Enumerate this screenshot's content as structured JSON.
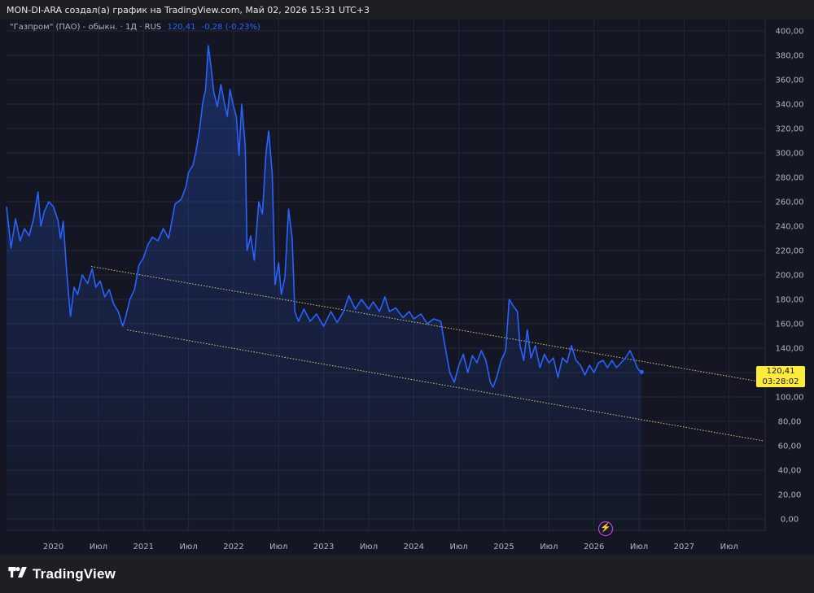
{
  "header": {
    "caption": "MON-DI-ARA создал(а) график на TradingView.com, Май 02, 2026 15:31 UTC+3"
  },
  "legend": {
    "symbol": "\"Газпром\" (ПАО) - обыкн. · 1Д · RUS",
    "price": "120,41",
    "change": "-0,28 (-0,23%)"
  },
  "price_tag": {
    "price": "120,41",
    "countdown": "03:28:02"
  },
  "brand": {
    "name": "TradingView",
    "logo_icon": "tradingview-logo-icon"
  },
  "colors": {
    "line": "#2962ff",
    "channel": "#e8e08c",
    "price_tag_bg": "#ffeb3b",
    "background": "#141723"
  },
  "chart_data": {
    "type": "area",
    "title": "",
    "xlabel": "",
    "ylabel": "",
    "ylim": [
      0,
      400
    ],
    "grid": true,
    "y_ticks": [
      "400,00",
      "380,00",
      "360,00",
      "340,00",
      "320,00",
      "300,00",
      "280,00",
      "260,00",
      "240,00",
      "220,00",
      "200,00",
      "180,00",
      "160,00",
      "140,00",
      "120,00",
      "100,00",
      "80,00",
      "60,00",
      "40,00",
      "20,00",
      "0,00"
    ],
    "x_ticks": [
      {
        "label": "2020",
        "date": 2020.0
      },
      {
        "label": "Июл",
        "date": 2020.5
      },
      {
        "label": "2021",
        "date": 2021.0
      },
      {
        "label": "Июл",
        "date": 2021.5
      },
      {
        "label": "2022",
        "date": 2022.0
      },
      {
        "label": "Июл",
        "date": 2022.5
      },
      {
        "label": "2023",
        "date": 2023.0
      },
      {
        "label": "Июл",
        "date": 2023.5
      },
      {
        "label": "2024",
        "date": 2024.0
      },
      {
        "label": "Июл",
        "date": 2024.5
      },
      {
        "label": "2025",
        "date": 2025.0
      },
      {
        "label": "Июл",
        "date": 2025.5
      },
      {
        "label": "2026",
        "date": 2026.0
      },
      {
        "label": "Июл",
        "date": 2026.5
      },
      {
        "label": "2027",
        "date": 2027.0
      },
      {
        "label": "Июл",
        "date": 2027.5
      }
    ],
    "series": [
      {
        "values": [
          [
            2019.48,
            256
          ],
          [
            2019.53,
            222
          ],
          [
            2019.58,
            246
          ],
          [
            2019.63,
            228
          ],
          [
            2019.68,
            238
          ],
          [
            2019.73,
            232
          ],
          [
            2019.78,
            246
          ],
          [
            2019.83,
            268
          ],
          [
            2019.86,
            240
          ],
          [
            2019.9,
            252
          ],
          [
            2019.95,
            260
          ],
          [
            2020.0,
            256
          ],
          [
            2020.05,
            245
          ],
          [
            2020.08,
            230
          ],
          [
            2020.11,
            244
          ],
          [
            2020.15,
            200
          ],
          [
            2020.19,
            166
          ],
          [
            2020.23,
            190
          ],
          [
            2020.27,
            184
          ],
          [
            2020.32,
            200
          ],
          [
            2020.38,
            193
          ],
          [
            2020.43,
            205
          ],
          [
            2020.47,
            190
          ],
          [
            2020.52,
            195
          ],
          [
            2020.57,
            182
          ],
          [
            2020.62,
            188
          ],
          [
            2020.67,
            176
          ],
          [
            2020.72,
            170
          ],
          [
            2020.77,
            158
          ],
          [
            2020.8,
            165
          ],
          [
            2020.85,
            180
          ],
          [
            2020.9,
            188
          ],
          [
            2020.95,
            208
          ],
          [
            2021.0,
            214
          ],
          [
            2021.05,
            225
          ],
          [
            2021.1,
            231
          ],
          [
            2021.16,
            228
          ],
          [
            2021.22,
            238
          ],
          [
            2021.28,
            230
          ],
          [
            2021.35,
            258
          ],
          [
            2021.42,
            262
          ],
          [
            2021.47,
            272
          ],
          [
            2021.5,
            284
          ],
          [
            2021.55,
            290
          ],
          [
            2021.58,
            300
          ],
          [
            2021.62,
            318
          ],
          [
            2021.66,
            342
          ],
          [
            2021.69,
            352
          ],
          [
            2021.72,
            388
          ],
          [
            2021.75,
            370
          ],
          [
            2021.78,
            350
          ],
          [
            2021.82,
            338
          ],
          [
            2021.86,
            356
          ],
          [
            2021.9,
            340
          ],
          [
            2021.93,
            330
          ],
          [
            2021.96,
            352
          ],
          [
            2022.0,
            338
          ],
          [
            2022.03,
            330
          ],
          [
            2022.06,
            298
          ],
          [
            2022.09,
            340
          ],
          [
            2022.13,
            306
          ],
          [
            2022.15,
            220
          ],
          [
            2022.19,
            232
          ],
          [
            2022.23,
            212
          ],
          [
            2022.28,
            260
          ],
          [
            2022.32,
            250
          ],
          [
            2022.36,
            300
          ],
          [
            2022.39,
            318
          ],
          [
            2022.43,
            282
          ],
          [
            2022.46,
            192
          ],
          [
            2022.5,
            210
          ],
          [
            2022.53,
            184
          ],
          [
            2022.57,
            198
          ],
          [
            2022.61,
            254
          ],
          [
            2022.65,
            230
          ],
          [
            2022.68,
            170
          ],
          [
            2022.72,
            162
          ],
          [
            2022.78,
            172
          ],
          [
            2022.85,
            162
          ],
          [
            2022.92,
            168
          ],
          [
            2023.0,
            158
          ],
          [
            2023.08,
            170
          ],
          [
            2023.15,
            161
          ],
          [
            2023.22,
            170
          ],
          [
            2023.28,
            183
          ],
          [
            2023.35,
            172
          ],
          [
            2023.42,
            180
          ],
          [
            2023.5,
            172
          ],
          [
            2023.55,
            178
          ],
          [
            2023.62,
            170
          ],
          [
            2023.68,
            182
          ],
          [
            2023.73,
            170
          ],
          [
            2023.8,
            173
          ],
          [
            2023.88,
            165
          ],
          [
            2023.95,
            170
          ],
          [
            2024.0,
            164
          ],
          [
            2024.08,
            168
          ],
          [
            2024.15,
            160
          ],
          [
            2024.22,
            164
          ],
          [
            2024.3,
            162
          ],
          [
            2024.35,
            140
          ],
          [
            2024.4,
            120
          ],
          [
            2024.45,
            112
          ],
          [
            2024.5,
            126
          ],
          [
            2024.55,
            135
          ],
          [
            2024.6,
            120
          ],
          [
            2024.65,
            134
          ],
          [
            2024.7,
            128
          ],
          [
            2024.75,
            138
          ],
          [
            2024.8,
            130
          ],
          [
            2024.85,
            112
          ],
          [
            2024.88,
            108
          ],
          [
            2024.92,
            116
          ],
          [
            2024.97,
            130
          ],
          [
            2025.02,
            138
          ],
          [
            2025.06,
            180
          ],
          [
            2025.1,
            175
          ],
          [
            2025.15,
            170
          ],
          [
            2025.18,
            142
          ],
          [
            2025.22,
            130
          ],
          [
            2025.26,
            155
          ],
          [
            2025.3,
            132
          ],
          [
            2025.35,
            142
          ],
          [
            2025.4,
            124
          ],
          [
            2025.45,
            135
          ],
          [
            2025.5,
            128
          ],
          [
            2025.55,
            132
          ],
          [
            2025.6,
            116
          ],
          [
            2025.65,
            132
          ],
          [
            2025.7,
            128
          ],
          [
            2025.75,
            142
          ],
          [
            2025.8,
            130
          ],
          [
            2025.85,
            126
          ],
          [
            2025.9,
            118
          ],
          [
            2025.95,
            126
          ],
          [
            2026.0,
            120
          ],
          [
            2026.05,
            128
          ],
          [
            2026.1,
            130
          ],
          [
            2026.15,
            124
          ],
          [
            2026.2,
            130
          ],
          [
            2026.25,
            124
          ],
          [
            2026.3,
            128
          ],
          [
            2026.35,
            132
          ],
          [
            2026.4,
            138
          ],
          [
            2026.45,
            130
          ],
          [
            2026.48,
            124
          ],
          [
            2026.5,
            122
          ],
          [
            2026.53,
            120.41
          ]
        ]
      }
    ],
    "channel_lines": [
      {
        "from": [
          2020.42,
          207
        ],
        "to": [
          2027.88,
          112
        ]
      },
      {
        "from": [
          2020.82,
          155
        ],
        "to": [
          2027.88,
          64
        ]
      }
    ]
  }
}
